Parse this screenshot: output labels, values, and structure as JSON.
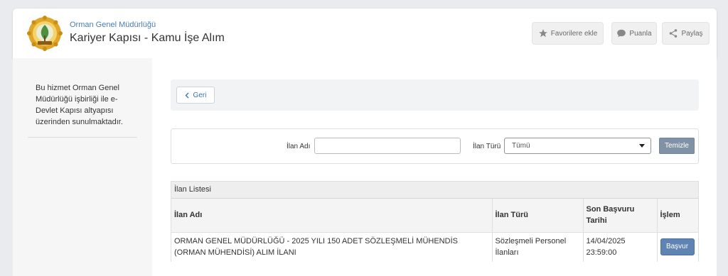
{
  "header": {
    "org_name": "Orman Genel Müdürlüğü",
    "app_title": "Kariyer Kapısı - Kamu İşe Alım",
    "buttons": {
      "favorite": "Favorilere ekle",
      "rate": "Puanla",
      "share": "Paylaş"
    }
  },
  "sidebar": {
    "info": "Bu hizmet Orman Genel Müdürlüğü işbirliği ile e-Devlet Kapısı altyapısı üzerinden sunulmaktadır."
  },
  "nav": {
    "back_label": "Geri"
  },
  "filter": {
    "ilan_adi_label": "İlan Adı",
    "ilan_adi_value": "",
    "ilan_turu_label": "İlan Türü",
    "ilan_turu_selected": "Tümü",
    "clear_label": "Temizle"
  },
  "list": {
    "title": "İlan Listesi",
    "columns": {
      "ilan_adi": "İlan Adı",
      "ilan_turu": "İlan Türü",
      "son_basvuru": "Son Başvuru Tarihi",
      "islem": "İşlem"
    },
    "rows": [
      {
        "ilan_adi": "ORMAN GENEL MÜDÜRLÜĞÜ - 2025 YILI 150 ADET SÖZLEŞMELİ MÜHENDİS (ORMAN MÜHENDİSİ) ALIM İLANI",
        "ilan_turu": "Sözleşmeli Personel İlanları",
        "son_basvuru": "14/04/2025 23:59:00",
        "action": "Başvur"
      }
    ]
  },
  "icons": {
    "favorite": "star-icon",
    "rate": "speech-bubble-icon",
    "share": "share-icon",
    "back": "chevron-left-icon",
    "select": "caret-down-icon"
  },
  "colors": {
    "link_blue": "#4a7fb5",
    "apply_button": "#5f83b3",
    "clear_button": "#8292a6"
  }
}
